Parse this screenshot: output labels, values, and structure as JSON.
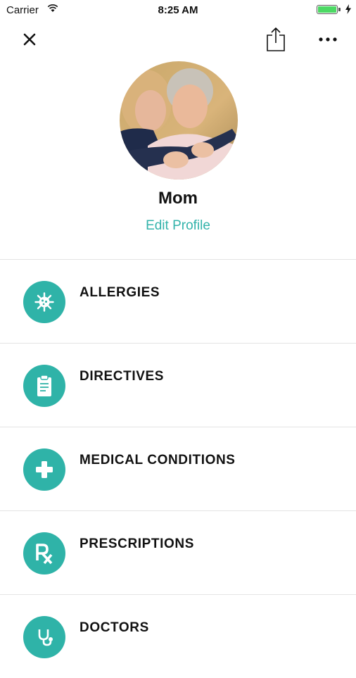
{
  "status_bar": {
    "carrier": "Carrier",
    "time": "8:25 AM"
  },
  "navbar": {
    "close_icon": "close-icon",
    "share_icon": "share-icon",
    "more_icon": "more-icon"
  },
  "profile": {
    "name": "Mom",
    "edit_label": "Edit Profile"
  },
  "accent_color": "#2fb3a8",
  "categories": [
    {
      "label": "ALLERGIES",
      "icon": "allergen-icon"
    },
    {
      "label": "DIRECTIVES",
      "icon": "clipboard-icon"
    },
    {
      "label": "MEDICAL CONDITIONS",
      "icon": "plus-icon"
    },
    {
      "label": "PRESCRIPTIONS",
      "icon": "rx-icon"
    },
    {
      "label": "DOCTORS",
      "icon": "stethoscope-icon"
    }
  ]
}
